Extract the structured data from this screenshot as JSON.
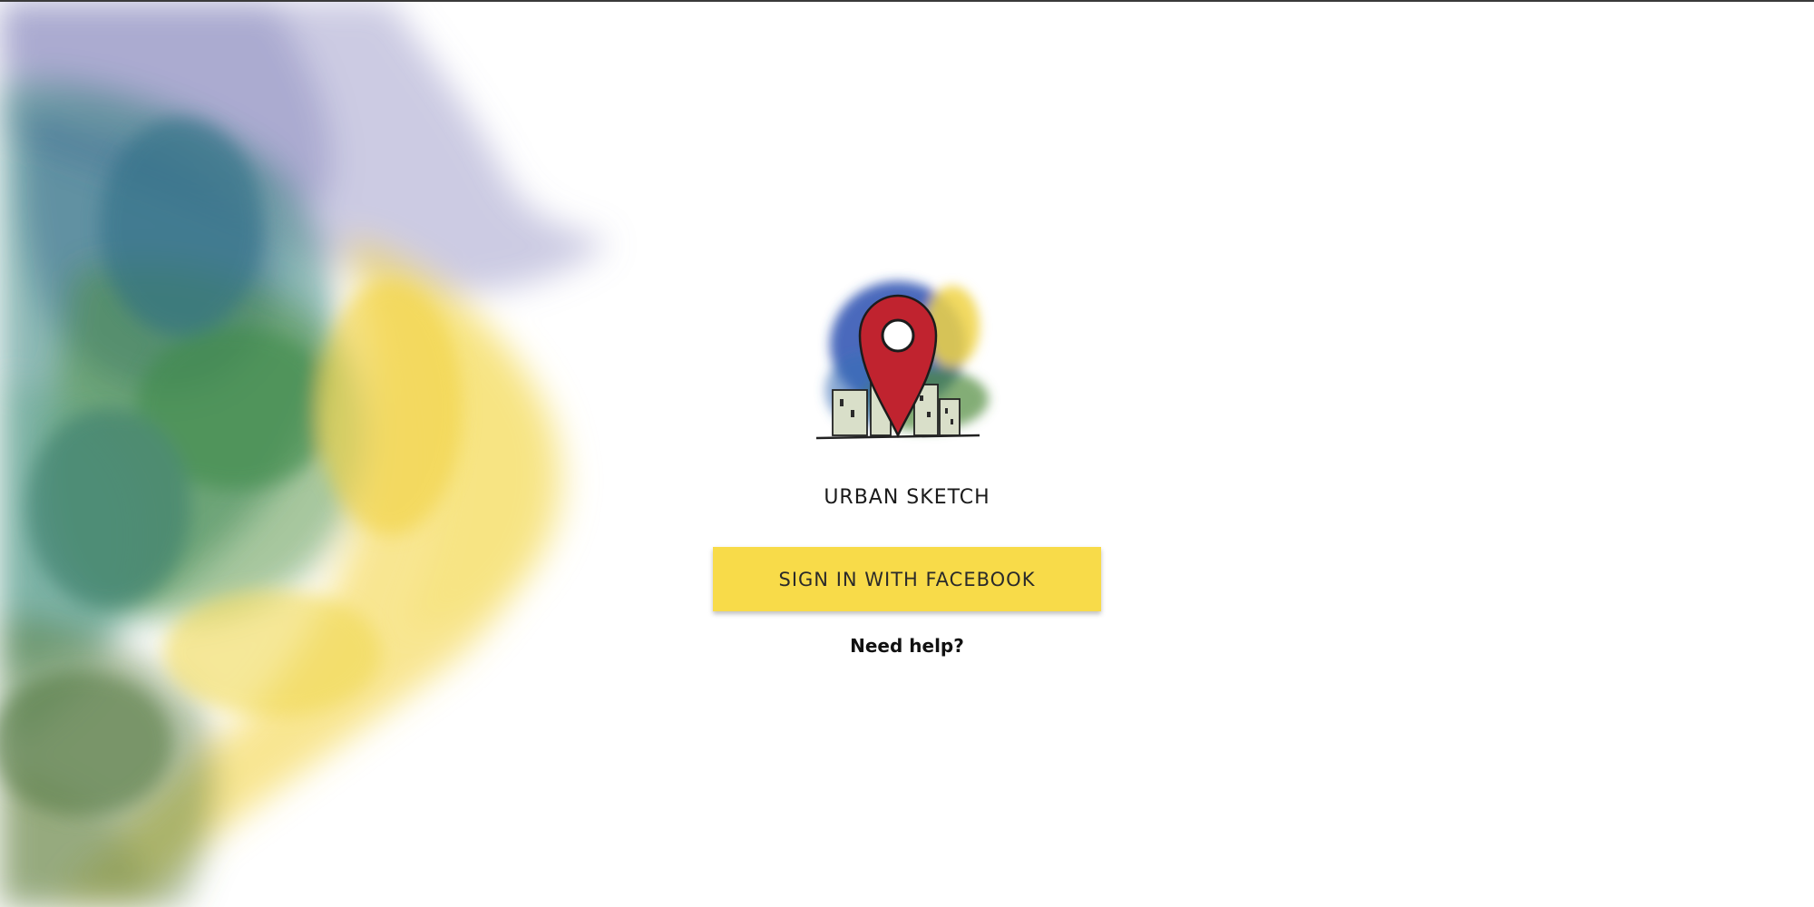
{
  "app": {
    "title": "URBAN SKETCH"
  },
  "auth": {
    "facebook_button_label": "SIGN IN WITH FACEBOOK",
    "help_link_label": "Need help?"
  },
  "logo": {
    "icon": "map-pin-city-icon"
  },
  "colors": {
    "button_background": "#f8db49",
    "pin_red": "#c0232f",
    "watercolor_purple": "#8f8cc2",
    "watercolor_teal": "#2f7f7a",
    "watercolor_green": "#4d8f3b",
    "watercolor_yellow": "#f3d64a"
  }
}
